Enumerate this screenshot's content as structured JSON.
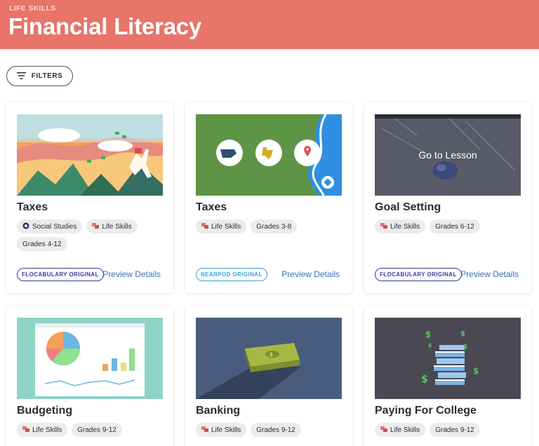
{
  "header": {
    "eyebrow": "LIFE SKILLS",
    "title": "Financial Literacy",
    "bg_color": "#e8746a"
  },
  "filters": {
    "label": "FILTERS",
    "icon": "filter-lines-icon"
  },
  "colors": {
    "preview_link": "#3b6fb6",
    "flocabulary_badge": "#3a3a9a",
    "nearpod_badge": "#3ea2d8",
    "tag_bg": "#ececee",
    "life_skills_icon": "#e8746a",
    "social_studies_icon": "#2b2b5e"
  },
  "cards": [
    {
      "title": "Taxes",
      "tags": [
        {
          "icon": "social-studies-icon",
          "label": "Social Studies"
        },
        {
          "icon": "life-skills-icon",
          "label": "Life Skills"
        },
        {
          "icon": "",
          "label": "Grades 4-12"
        }
      ],
      "badge": "FLOCABULARY ORIGINAL",
      "preview": "Preview Details"
    },
    {
      "title": "Taxes",
      "tags": [
        {
          "icon": "life-skills-icon",
          "label": "Life Skills"
        },
        {
          "icon": "",
          "label": "Grades 3-8"
        }
      ],
      "badge": "NEARPOD ORIGINAL",
      "preview": "Preview Details"
    },
    {
      "title": "Goal Setting",
      "overlay": "Go to Lesson",
      "tags": [
        {
          "icon": "life-skills-icon",
          "label": "Life Skills"
        },
        {
          "icon": "",
          "label": "Grades 6-12"
        }
      ],
      "badge": "FLOCABULARY ORIGINAL",
      "preview": "Preview Details"
    },
    {
      "title": "Budgeting",
      "tags": [
        {
          "icon": "life-skills-icon",
          "label": "Life Skills"
        },
        {
          "icon": "",
          "label": "Grades 9-12"
        }
      ]
    },
    {
      "title": "Banking",
      "tags": [
        {
          "icon": "life-skills-icon",
          "label": "Life Skills"
        },
        {
          "icon": "",
          "label": "Grades 9-12"
        }
      ]
    },
    {
      "title": "Paying For College",
      "tags": [
        {
          "icon": "life-skills-icon",
          "label": "Life Skills"
        },
        {
          "icon": "",
          "label": "Grades 9-12"
        }
      ]
    }
  ]
}
